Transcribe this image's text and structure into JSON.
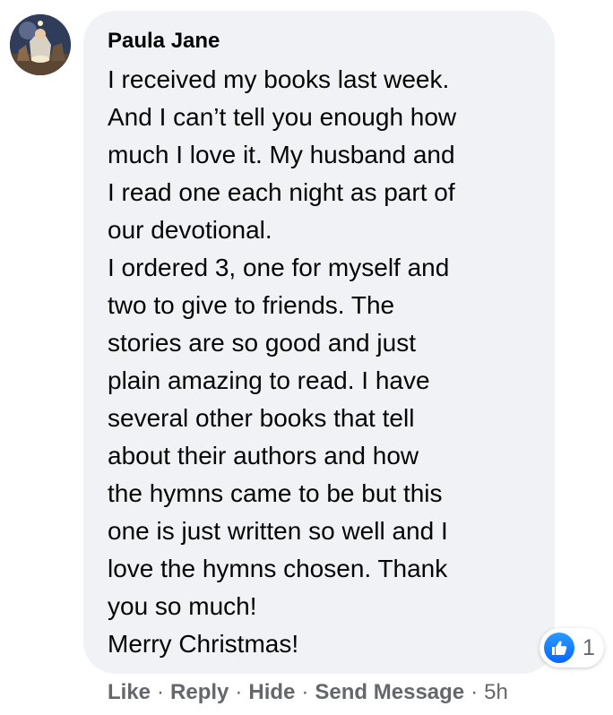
{
  "comment": {
    "author": "Paula Jane",
    "text_lines": [
      "I received my books last week.",
      "And I can’t tell you enough how",
      "much I love it. My husband and",
      "I read one each night as part of",
      "our devotional.",
      "I ordered 3, one for myself and",
      "two to give to friends. The",
      "stories are so good and just",
      "plain amazing to read. I have",
      "several other books that tell",
      "about their authors and how",
      "the hymns came to be but this",
      "one is just written so well and I",
      "love the hymns chosen. Thank",
      "you so much!",
      "Merry Christmas!"
    ],
    "reactions": {
      "icon": "like-icon",
      "count": "1"
    },
    "actions": {
      "like": "Like",
      "reply": "Reply",
      "hide": "Hide",
      "send_message": "Send Message",
      "separator": "·",
      "timestamp": "5h"
    }
  },
  "colors": {
    "bubble": "#f0f2f5",
    "text": "#050505",
    "secondary_text": "#65676b",
    "like_blue": "#0866ff"
  }
}
